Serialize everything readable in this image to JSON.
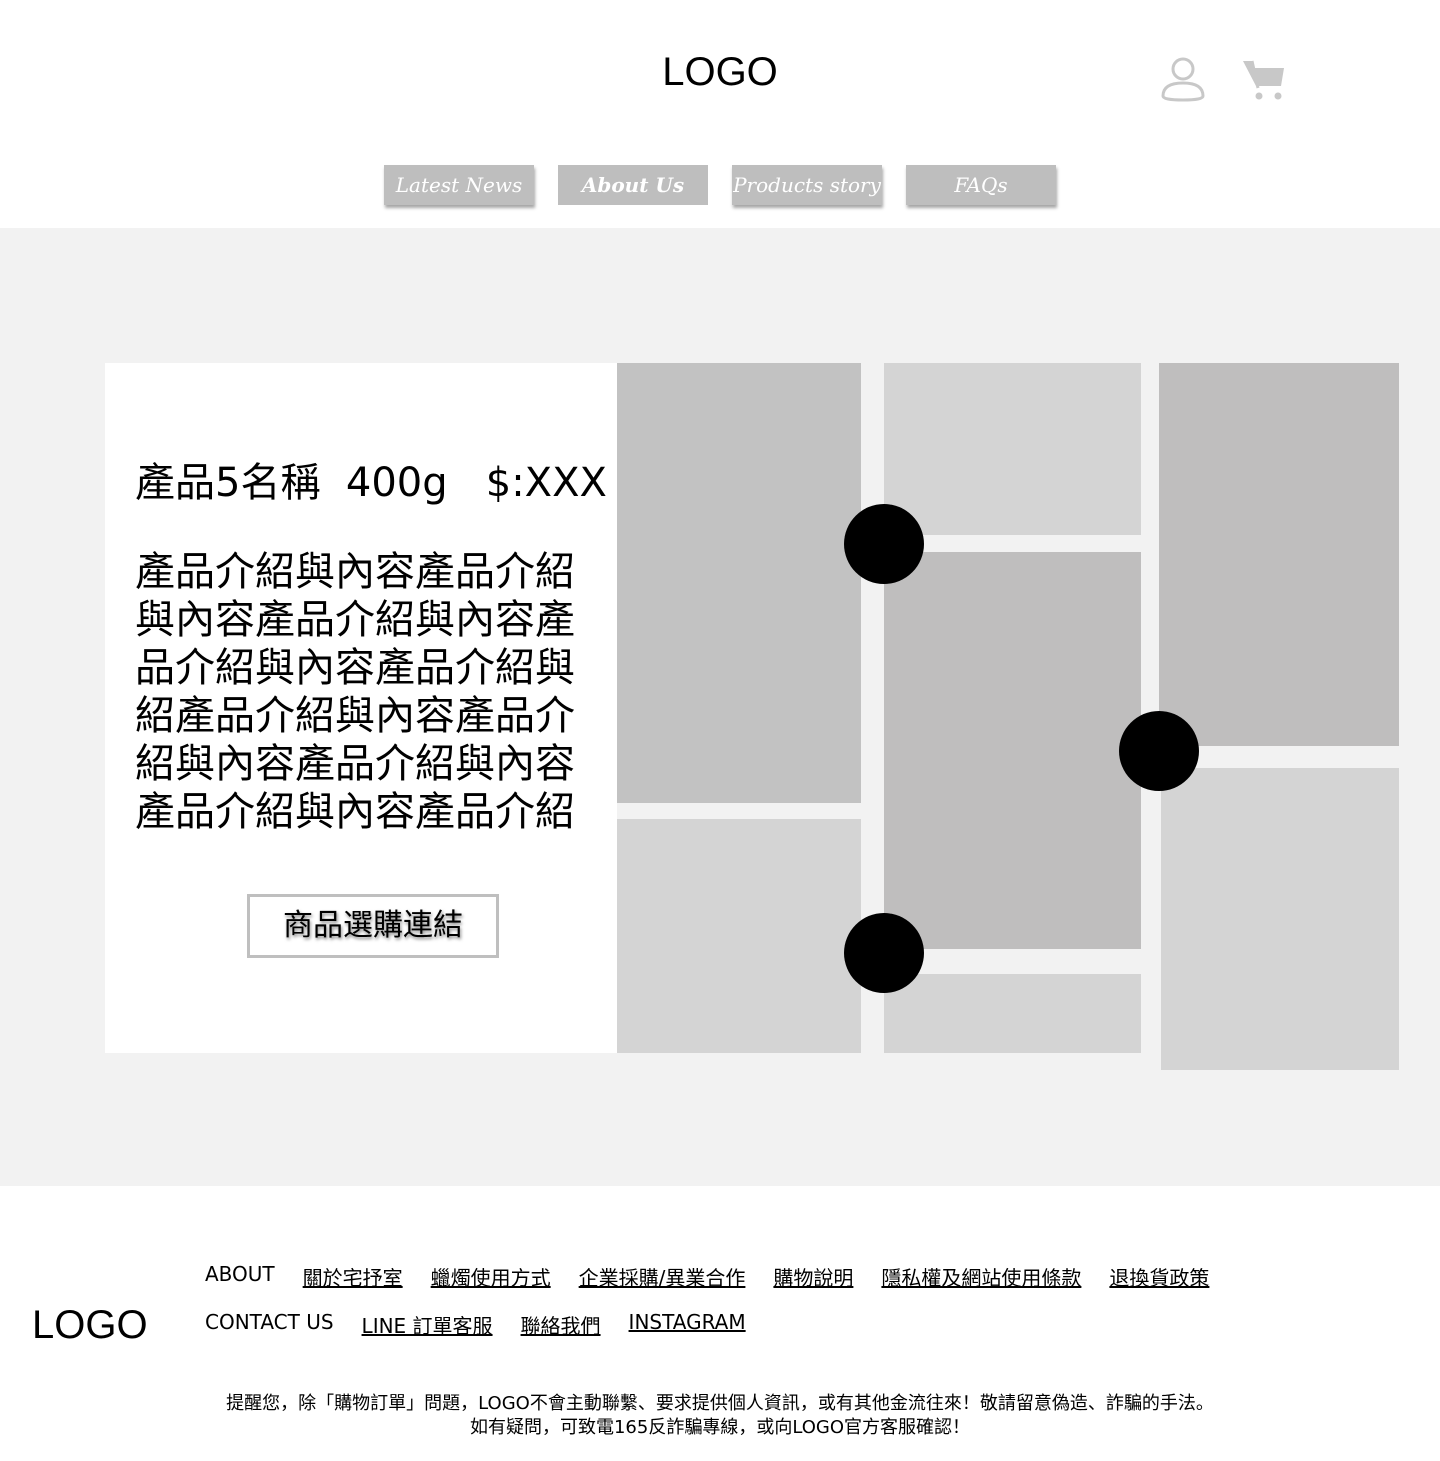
{
  "header": {
    "logo": "LOGO",
    "icons": [
      "user-icon",
      "cart-icon"
    ]
  },
  "nav": {
    "tabs": [
      {
        "label": "Latest News"
      },
      {
        "label": "About Us",
        "active": true
      },
      {
        "label": "Products story"
      },
      {
        "label": "FAQs"
      }
    ]
  },
  "product": {
    "title": "產品5名稱  400g   $:XXX",
    "description": "產品介紹與內容產品介紹與內容產品介紹與內容產品介紹與內容產品介紹與紹產品介紹與內容產品介紹與內容產品介紹與內容產品介紹與內容產品介紹",
    "buy_button": "商品選購連結"
  },
  "footer": {
    "logo": "LOGO",
    "row1": {
      "heading": "ABOUT",
      "links": [
        "關於宅抒室",
        "蠟燭使用方式",
        "企業採購/異業合作",
        "購物說明",
        "隱私權及網站使用條款",
        "退換貨政策"
      ]
    },
    "row2": {
      "heading": "CONTACT US",
      "links": [
        "LINE 訂單客服",
        "聯絡我們",
        "INSTAGRAM"
      ]
    },
    "notice_line1": "提醒您，除「購物訂單」問題，LOGO不會主動聯繫、要求提供個人資訊，或有其他金流往來！敬請留意偽造、詐騙的手法。",
    "notice_line2": "如有疑問，可致電165反詐騙專線，或向LOGO官方客服確認！"
  },
  "colors": {
    "hero_background": "#f2f2f2",
    "nav_tab": "#bebebe",
    "placeholder_dark": "#c2c2c2",
    "placeholder_light": "#d4d4d4",
    "dot": "#000000"
  }
}
